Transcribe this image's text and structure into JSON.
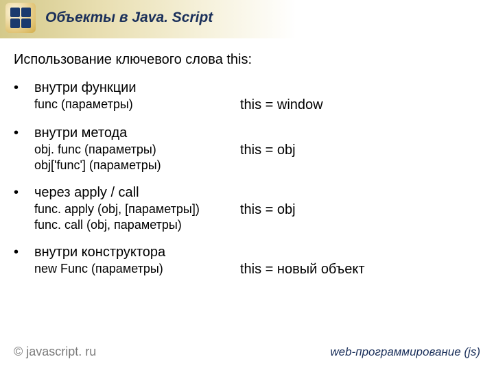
{
  "header": {
    "title": "Объекты в Java. Script"
  },
  "intro": "Использование ключевого слова this:",
  "sections": [
    {
      "heading": "внутри функции",
      "lines": [
        {
          "left": "func (параметры)",
          "right": "this = window"
        }
      ]
    },
    {
      "heading": "внутри метода",
      "lines": [
        {
          "left": "obj. func (параметры)",
          "right": "this = obj"
        },
        {
          "left": "obj['func'] (параметры)",
          "right": ""
        }
      ]
    },
    {
      "heading": "через apply / call",
      "lines": [
        {
          "left": "func. apply (obj, [параметры])",
          "right": "this = obj"
        },
        {
          "left": "func. call (obj, параметры)",
          "right": ""
        }
      ]
    },
    {
      "heading": "внутри конструктора",
      "lines": [
        {
          "left": "new Func (параметры)",
          "right": "this = новый объект"
        }
      ]
    }
  ],
  "footer": {
    "left": "© javascript. ru",
    "right": "web-программирование (js)"
  }
}
